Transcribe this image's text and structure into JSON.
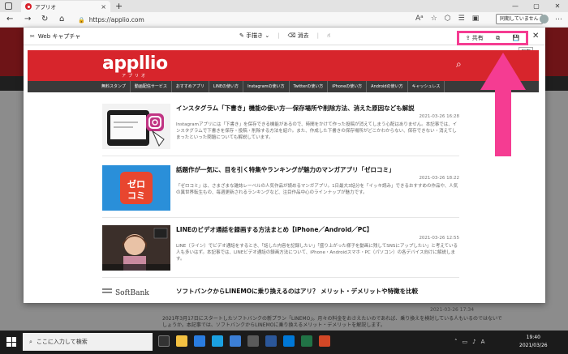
{
  "browser": {
    "tab_title": "アプリオ",
    "url": "https://applio.com",
    "sync_label": "同期していません"
  },
  "capture": {
    "title": "Web キャプチャ",
    "draw_label": "手描き",
    "erase_label": "消去",
    "share_label": "共有",
    "save_tooltip": "保存"
  },
  "site": {
    "logo": "appllio",
    "logo_sub": "アプリオ",
    "nav": [
      "無料スタンプ",
      "動画配信サービス",
      "おすすめアプリ",
      "LINEの使い方",
      "Instagramの使い方",
      "Twitterの使い方",
      "iPhoneの使い方",
      "Androidの使い方",
      "キャッシュレス"
    ]
  },
  "articles": [
    {
      "title": "インスタグラム「下書き」機能の使い方──保存場所や削除方法、消えた原因なども解説",
      "date": "2021-03-26 16:28",
      "body": "Instagramアプリには「下書き」を保存できる機能があるので、時間をかけて作った投稿が消えてしまう心配はありません。本記事では、インスタグラムで下書きを保存・投稿・削除する方法を紹介。また、作成した下書きの保存場所がどこかわからない、保存できない・消えてしまったといった問題についても解説しています。"
    },
    {
      "title": "話題作が一気に、目を引く特集やランキングが魅力のマンガアプリ「ゼロコミ」",
      "date": "2021-03-26 18:22",
      "body": "「ゼロコミ」は、さまざまな雑誌レーベルの人気作品が読めるマンガアプリ。1日最大3話分を「イッキ読み」できるおすすめの作品や、人気の異世界転生もの、毎週更新されるランキングなど、注目作品中心のラインナップが魅力です。"
    },
    {
      "title": "LINEのビデオ通話を録画する方法まとめ【iPhone／Android／PC】",
      "date": "2021-03-26 12:55",
      "body": "LINE（ライン）でビデオ通話をするとき、「話した内容を記録したい」「盛り上がった様子を動画に残してSNSにアップしたい」と考えている人も多いはず。本記事では、LINEビデオ通話の録画方法について、iPhone・Androidスマホ・PC（パソコン）の各デバイス向けに解説します。"
    },
    {
      "title": "ソフトバンクからLINEMOに乗り換えるのはアリ？ メリット・デメリットや特徴を比較",
      "date": "2021-03-26 17:34",
      "body": "2021年3月17日にスタートしたソフトバンクの新プラン「LINEMO」。月々の料金をおさえたいのであれば、乗り換えを検討している人もいるのではないでしょうか。本記事では、ソフトバンクからLINEMOに乗り換えるメリット・デメリットを解説します。"
    }
  ],
  "taskbar": {
    "search_placeholder": "ここに入力して検索",
    "time": "19:40",
    "date": "2021/03/26",
    "ime": "A"
  },
  "colors": {
    "brand_red": "#d7252c",
    "highlight_pink": "#f53c92",
    "nav_dark": "#3a3a3a"
  }
}
